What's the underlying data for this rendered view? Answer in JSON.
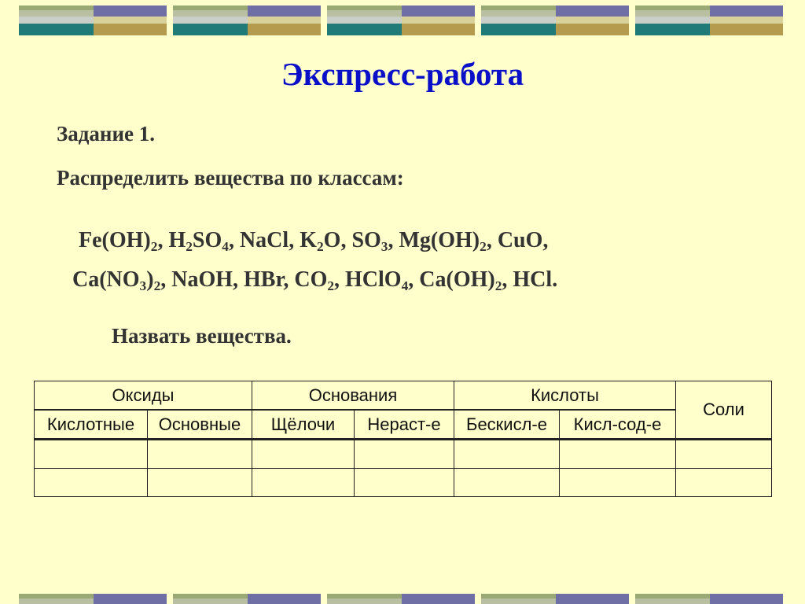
{
  "slide": {
    "title": "Экспресс-работа",
    "task": "Задание 1.",
    "instruction": "Распределить вещества по классам:",
    "formulas_line1": [
      {
        "parts": [
          "Fe(OH)",
          "2"
        ],
        "sep": ", "
      },
      {
        "parts": [
          "H",
          "2",
          "SO",
          "4"
        ],
        "sep": ", "
      },
      {
        "parts": [
          "NaCl"
        ],
        "sep": ", "
      },
      {
        "parts": [
          "K",
          "2",
          "O"
        ],
        "sep": ", "
      },
      {
        "parts": [
          "SO",
          "3"
        ],
        "sep": ", "
      },
      {
        "parts": [
          "Mg(OH)",
          "2"
        ],
        "sep": ", "
      },
      {
        "parts": [
          "CuO"
        ],
        "sep": ","
      }
    ],
    "formulas_line2": [
      {
        "parts": [
          "Ca(NO",
          "3",
          ")",
          "2"
        ],
        "sep": ", "
      },
      {
        "parts": [
          "NaOH"
        ],
        "sep": ", "
      },
      {
        "parts": [
          "HBr"
        ],
        "sep": ", "
      },
      {
        "parts": [
          "CO",
          "2"
        ],
        "sep": ", "
      },
      {
        "parts": [
          "HClO",
          "4"
        ],
        "sep": ", "
      },
      {
        "parts": [
          "Ca(OH)",
          "2"
        ],
        "sep": ", "
      },
      {
        "parts": [
          "HCl"
        ],
        "sep": "."
      }
    ],
    "naming": "Назвать вещества."
  },
  "table": {
    "groups": [
      "Оксиды",
      "Основания",
      "Кислоты"
    ],
    "salts": "Соли",
    "subheaders": [
      "Кислотные",
      "Основные",
      "Щёлочи",
      "Нераст-е",
      "Бескисл-е",
      "Кисл-сод-е"
    ],
    "empty_rows": 2
  },
  "colors": {
    "background": "#ffffcc",
    "title": "#0a10c8",
    "text": "#333333"
  }
}
